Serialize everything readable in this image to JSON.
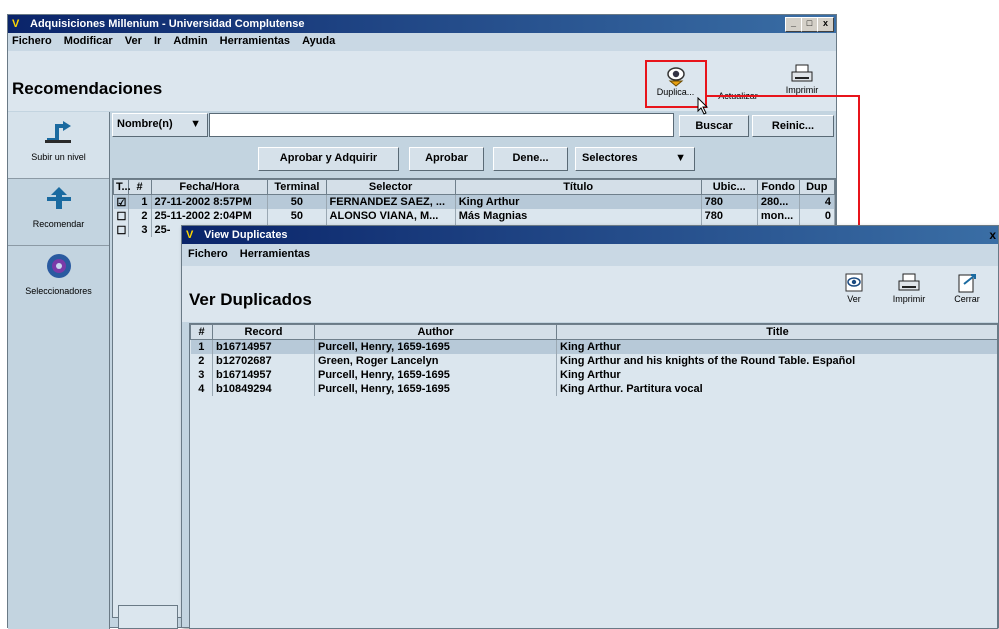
{
  "main_window": {
    "title": "Adquisiciones Millenium - Universidad Complutense",
    "controls": [
      "_",
      "□",
      "x"
    ],
    "menu": [
      "Fichero",
      "Modificar",
      "Ver",
      "Ir",
      "Admin",
      "Herramientas",
      "Ayuda"
    ],
    "page_title": "Recomendaciones",
    "toolbar": {
      "duplicates": "Duplica...",
      "refresh": "Actualizar",
      "print": "Imprimir"
    },
    "nav": [
      "Subir un nivel",
      "Recomendar",
      "Seleccionadores"
    ],
    "search": {
      "field_label": "Nombre(n)",
      "value": "",
      "search_btn": "Buscar",
      "reset_btn": "Reinic..."
    },
    "actions": {
      "approve_acquire": "Aprobar y Adquirir",
      "approve": "Aprobar",
      "deny": "Dene...",
      "selectors": "Selectores"
    },
    "columns": [
      "T...",
      "#",
      "Fecha/Hora",
      "Terminal",
      "Selector",
      "Título",
      "Ubic...",
      "Fondo",
      "Dup"
    ],
    "rows": [
      {
        "check": "☑",
        "n": "1",
        "date": "27-11-2002 8:57PM",
        "terminal": "50",
        "selector": "FERNANDEZ SAEZ, ...",
        "title": "King Arthur",
        "loc": "780",
        "fund": "280...",
        "dup": "4"
      },
      {
        "check": "☐",
        "n": "2",
        "date": "25-11-2002 2:04PM",
        "terminal": "50",
        "selector": "ALONSO VIANA, M...",
        "title": "Más Magnias",
        "loc": "780",
        "fund": "mon...",
        "dup": "0"
      },
      {
        "check": "☐",
        "n": "3",
        "date": "25-",
        "terminal": "",
        "selector": "",
        "title": "",
        "loc": "",
        "fund": "",
        "dup": ""
      }
    ]
  },
  "dialog": {
    "title": "View Duplicates",
    "close": "x",
    "menu": [
      "Fichero",
      "Herramientas"
    ],
    "heading": "Ver Duplicados",
    "toolbar": {
      "view": "Ver",
      "print": "Imprimir",
      "close": "Cerrar"
    },
    "columns": [
      "#",
      "Record",
      "Author",
      "Title"
    ],
    "rows": [
      {
        "n": "1",
        "record": "b16714957",
        "author": "Purcell, Henry, 1659-1695",
        "title": "King Arthur"
      },
      {
        "n": "2",
        "record": "b12702687",
        "author": "Green, Roger Lancelyn",
        "title": "King Arthur and his knights of the Round Table. Español"
      },
      {
        "n": "3",
        "record": "b16714957",
        "author": "Purcell, Henry, 1659-1695",
        "title": "King Arthur"
      },
      {
        "n": "4",
        "record": "b10849294",
        "author": "Purcell, Henry, 1659-1695",
        "title": "King Arthur. Partitura vocal"
      }
    ]
  },
  "colors": {
    "highlight_box": "#e8141b",
    "titlebar": "#0a246a",
    "panel": "#c3d4e0"
  }
}
